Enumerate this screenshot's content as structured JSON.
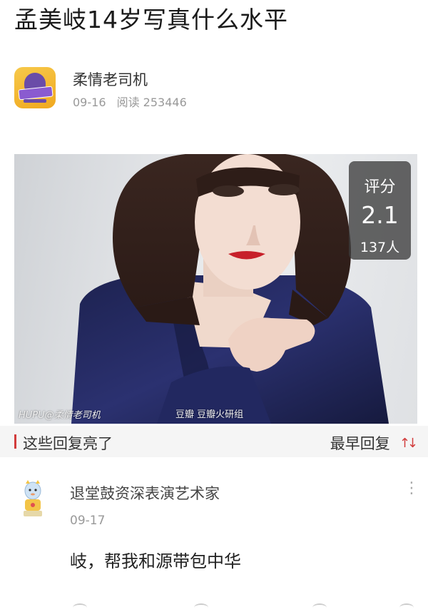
{
  "post": {
    "title": "孟美岐14岁写真什么水平",
    "author": "柔情老司机",
    "date": "09-16",
    "reads_label": "阅读 253446"
  },
  "photo": {
    "score_label": "评分",
    "score_value": "2.1",
    "score_count": "137人",
    "watermark": "HUPU@柔情老司机",
    "watermark2": "豆瓣  豆瓣火研组"
  },
  "replies_section": {
    "title": "这些回复亮了",
    "sort_label": "最早回复",
    "sort_icon": "↑↓"
  },
  "reply": {
    "user": "退堂鼓资深表演艺术家",
    "date": "09-17",
    "text": "岐，帮我和源带包中华",
    "more_icon": "⋮"
  },
  "colors": {
    "accent": "#d23c3c",
    "meta": "#999999",
    "score_bg": "#3c3c3c"
  }
}
